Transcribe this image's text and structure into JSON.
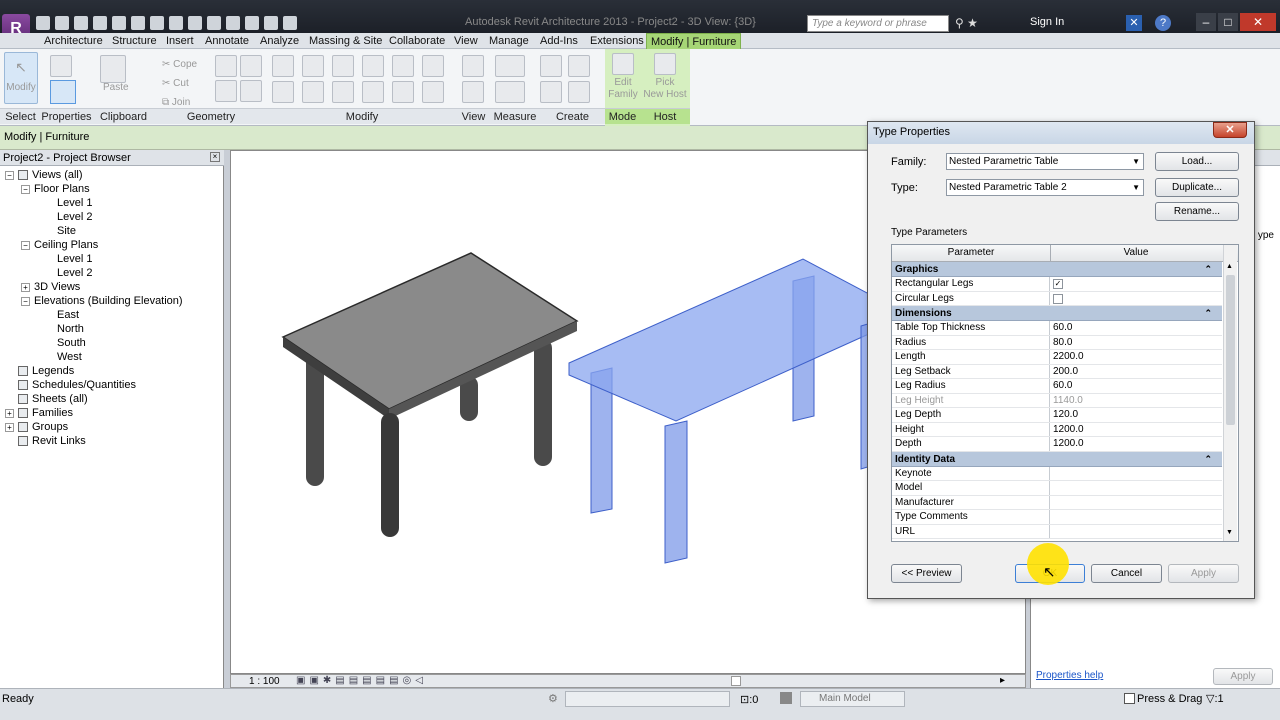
{
  "app": {
    "window_title": "Autodesk Revit Architecture 2013 -   Project2 - 3D View: {3D}",
    "search_placeholder": "Type a keyword or phrase",
    "sign_in": "Sign In"
  },
  "menu": [
    "Architecture",
    "Structure",
    "Insert",
    "Annotate",
    "Analyze",
    "Massing & Site",
    "Collaborate",
    "View",
    "Manage",
    "Add-Ins",
    "Extensions",
    "Modify | Furniture"
  ],
  "ribbon": {
    "modify_label": "Modify",
    "paste_label": "Paste",
    "clipboard_items": [
      "Cope",
      "Cut",
      "Join"
    ],
    "edit_family": "Edit\nFamily",
    "pick_new_host": "Pick\nNew Host",
    "panels": [
      "Select",
      "Properties",
      "Clipboard",
      "Geometry",
      "Modify",
      "View",
      "Measure",
      "Create",
      "Mode",
      "Host"
    ]
  },
  "options_bar": "Modify | Furniture",
  "project_browser": {
    "title": "Project2 - Project Browser",
    "items": [
      {
        "label": "Views (all)",
        "level": 0,
        "toggle": "−",
        "icon": true
      },
      {
        "label": "Floor Plans",
        "level": 1,
        "toggle": "−"
      },
      {
        "label": "Level 1",
        "level": 2
      },
      {
        "label": "Level 2",
        "level": 2
      },
      {
        "label": "Site",
        "level": 2
      },
      {
        "label": "Ceiling Plans",
        "level": 1,
        "toggle": "−"
      },
      {
        "label": "Level 1",
        "level": 2
      },
      {
        "label": "Level 2",
        "level": 2
      },
      {
        "label": "3D Views",
        "level": 1,
        "toggle": "+"
      },
      {
        "label": "Elevations (Building Elevation)",
        "level": 1,
        "toggle": "−"
      },
      {
        "label": "East",
        "level": 2
      },
      {
        "label": "North",
        "level": 2
      },
      {
        "label": "South",
        "level": 2
      },
      {
        "label": "West",
        "level": 2
      },
      {
        "label": "Legends",
        "level": 0,
        "icon": true
      },
      {
        "label": "Schedules/Quantities",
        "level": 0,
        "icon": true
      },
      {
        "label": "Sheets (all)",
        "level": 0,
        "icon": true
      },
      {
        "label": "Families",
        "level": 0,
        "toggle": "+",
        "icon": true
      },
      {
        "label": "Groups",
        "level": 0,
        "toggle": "+",
        "icon": true
      },
      {
        "label": "Revit Links",
        "level": 0,
        "icon": true
      }
    ]
  },
  "view_bar": {
    "scale": "1 : 100"
  },
  "properties_panel": {
    "help_link": "Properties help",
    "apply": "Apply",
    "side_text": "ype"
  },
  "status_bar": {
    "status": "Ready",
    "selection_count": ":0",
    "model": "Main Model",
    "press_drag": "Press & Drag",
    "filter_count": ":1"
  },
  "dialog": {
    "title": "Type Properties",
    "close": "✕",
    "family_label": "Family:",
    "family_value": "Nested Parametric Table",
    "type_label": "Type:",
    "type_value": "Nested Parametric Table 2",
    "load_button": "Load...",
    "duplicate_button": "Duplicate...",
    "rename_button": "Rename...",
    "type_parameters_label": "Type Parameters",
    "col_parameter": "Parameter",
    "col_value": "Value",
    "groups": [
      {
        "name": "Graphics",
        "rows": [
          {
            "param": "Rectangular Legs",
            "value": "",
            "checkbox": true,
            "checked": true
          },
          {
            "param": "Circular Legs",
            "value": "",
            "checkbox": true,
            "checked": false
          }
        ]
      },
      {
        "name": "Dimensions",
        "rows": [
          {
            "param": "Table Top Thickness",
            "value": "60.0"
          },
          {
            "param": "Radius",
            "value": "80.0"
          },
          {
            "param": "Length",
            "value": "2200.0"
          },
          {
            "param": "Leg Setback",
            "value": "200.0"
          },
          {
            "param": "Leg Radius",
            "value": "60.0"
          },
          {
            "param": "Leg Height",
            "value": "1140.0",
            "gray": true
          },
          {
            "param": "Leg Depth",
            "value": "120.0"
          },
          {
            "param": "Height",
            "value": "1200.0"
          },
          {
            "param": "Depth",
            "value": "1200.0"
          }
        ]
      },
      {
        "name": "Identity Data",
        "rows": [
          {
            "param": "Keynote",
            "value": ""
          },
          {
            "param": "Model",
            "value": ""
          },
          {
            "param": "Manufacturer",
            "value": ""
          },
          {
            "param": "Type Comments",
            "value": ""
          },
          {
            "param": "URL",
            "value": ""
          }
        ]
      }
    ],
    "preview_button": "<< Preview",
    "ok_button": "OK",
    "cancel_button": "Cancel",
    "apply_button": "Apply"
  }
}
